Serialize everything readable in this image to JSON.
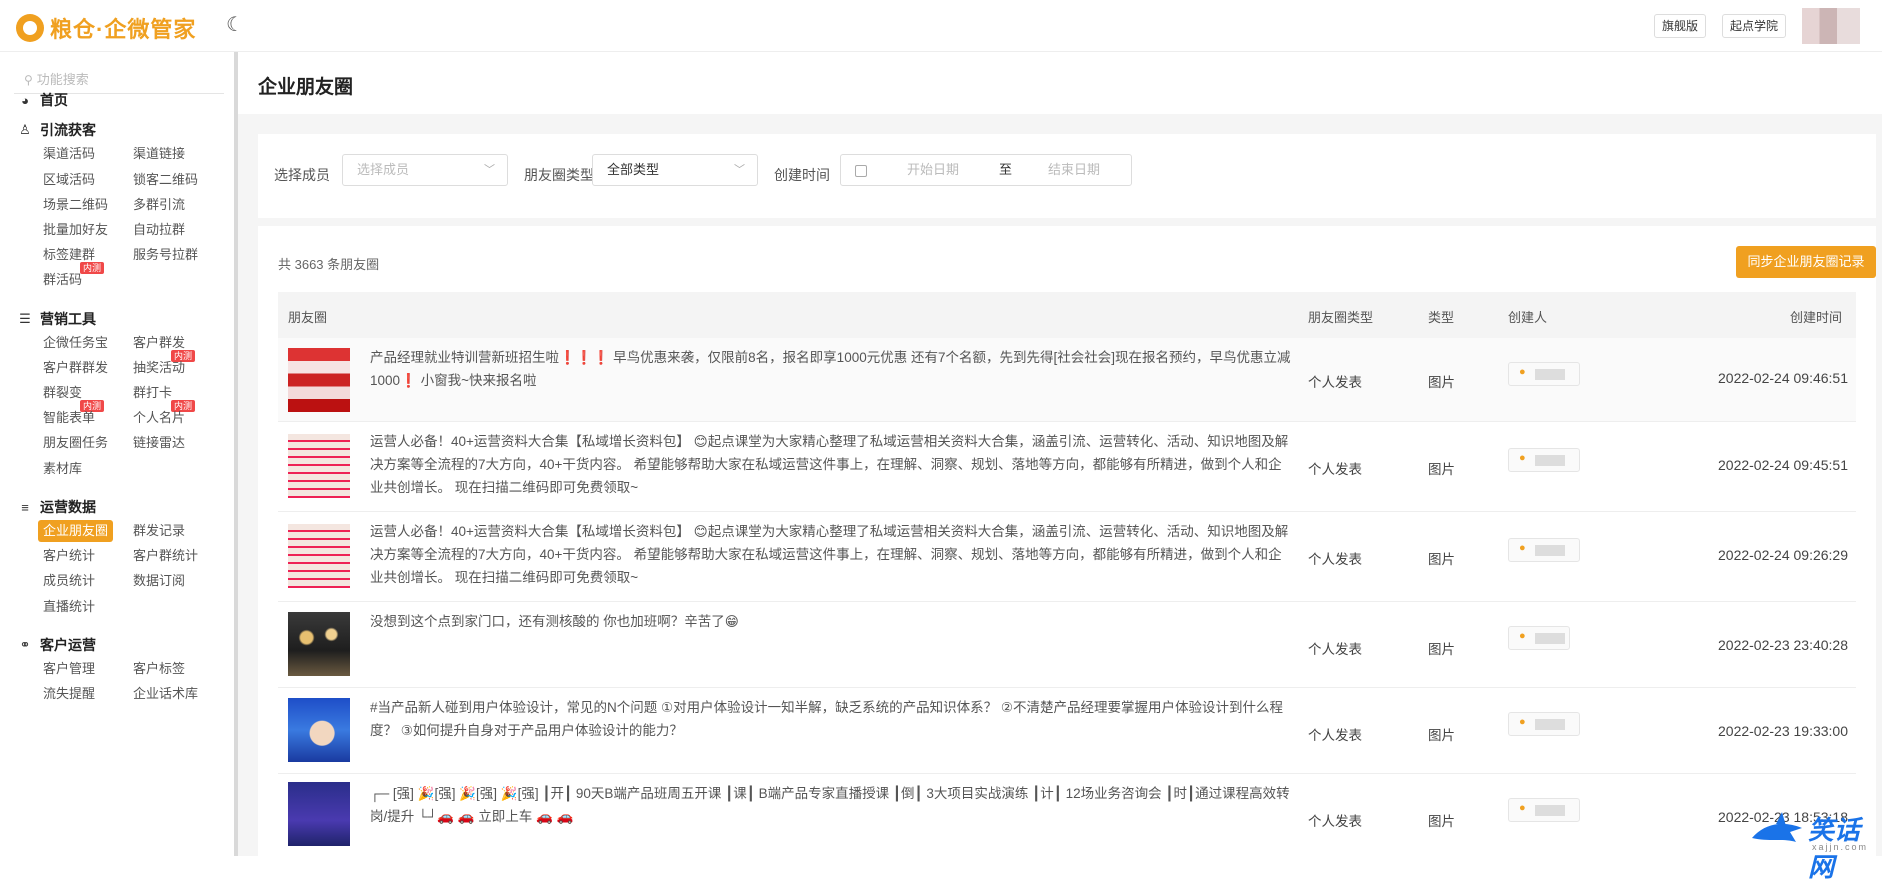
{
  "app": {
    "logo_text": "粮仓·企微管家",
    "flagship_label": "旗舰版",
    "academy_label": "起点学院"
  },
  "sidebar": {
    "search_placeholder": "功能搜索",
    "home": "首页",
    "sections": [
      {
        "title": "引流获客",
        "items": [
          "渠道活码",
          "渠道链接",
          "区域活码",
          "锁客二维码",
          "场景二维码",
          "多群引流",
          "批量加好友",
          "自动拉群",
          "标签建群",
          "服务号拉群",
          "群活码"
        ]
      },
      {
        "title": "营销工具",
        "items": [
          "企微任务宝",
          "客户群发",
          "客户群群发",
          "抽奖活动",
          "群裂变",
          "群打卡",
          "智能表单",
          "个人名片",
          "朋友圈任务",
          "链接雷达",
          "素材库"
        ]
      },
      {
        "title": "运营数据",
        "items": [
          "企业朋友圈",
          "群发记录",
          "客户统计",
          "客户群统计",
          "成员统计",
          "数据订阅",
          "直播统计"
        ]
      },
      {
        "title": "客户运营",
        "items": [
          "客户管理",
          "客户标签",
          "流失提醒",
          "企业话术库"
        ]
      }
    ],
    "badge": "内测"
  },
  "page": {
    "title": "企业朋友圈"
  },
  "filters": {
    "member_label": "选择成员",
    "member_placeholder": "选择成员",
    "type_label": "朋友圈类型",
    "type_value": "全部类型",
    "time_label": "创建时间",
    "start_placeholder": "开始日期",
    "sep": "至",
    "end_placeholder": "结束日期"
  },
  "table": {
    "count_text": "共 3663 条朋友圈",
    "sync_button": "同步企业朋友圈记录",
    "columns": [
      "朋友圈",
      "朋友圈类型",
      "类型",
      "创建人",
      "创建时间"
    ],
    "rows": [
      {
        "content": "产品经理就业特训营新班招生啦❗❗❗ 早鸟优惠来袭，仅限前8名，报名即享1000元优惠 还有7个名额，先到先得[社会社会]现在报名预约，早鸟优惠立减1000❗ 小窗我~快来报名啦",
        "type": "个人发表",
        "kind": "图片",
        "time": "2022-02-24 09:46:51"
      },
      {
        "content": "运营人必备！40+运营资料大合集【私域增长资料包】 😊起点课堂为大家精心整理了私域运营相关资料大合集，涵盖引流、运营转化、活动、知识地图及解决方案等全流程的7大方向，40+干货内容。 希望能够帮助大家在私域运营这件事上，在理解、洞察、规划、落地等方向，都能够有所精进，做到个人和企业共创增长。 现在扫描二维码即可免费领取~",
        "type": "个人发表",
        "kind": "图片",
        "time": "2022-02-24 09:45:51"
      },
      {
        "content": "运营人必备！40+运营资料大合集【私域增长资料包】 😊起点课堂为大家精心整理了私域运营相关资料大合集，涵盖引流、运营转化、活动、知识地图及解决方案等全流程的7大方向，40+干货内容。 希望能够帮助大家在私域运营这件事上，在理解、洞察、规划、落地等方向，都能够有所精进，做到个人和企业共创增长。 现在扫描二维码即可免费领取~",
        "type": "个人发表",
        "kind": "图片",
        "time": "2022-02-24 09:26:29"
      },
      {
        "content": "没想到这个点到家门口，还有测核酸的 你也加班啊？辛苦了😁",
        "type": "个人发表",
        "kind": "图片",
        "time": "2022-02-23 23:40:28"
      },
      {
        "content": "#当产品新人碰到用户体验设计，常见的N个问题 ①对用户体验设计一知半解，缺乏系统的产品知识体系？ ②不清楚产品经理要掌握用户体验设计到什么程度？ ③如何提升自身对于产品用户体验设计的能力？",
        "type": "个人发表",
        "kind": "图片",
        "time": "2022-02-23 19:33:00"
      },
      {
        "content": "┌─ [强] 🎉[强] 🎉[强] 🎉[强] ┃开┃ 90天B端产品班周五开课 ┃课┃ B端产品专家直播授课 ┃倒┃ 3大项目实战演练 ┃计┃ 12场业务咨询会 ┃时┃通过课程高效转岗/提升 └┘🚗 🚗 立即上车 🚗 🚗",
        "type": "个人发表",
        "kind": "图片",
        "time": "2022-02-23 18:53:18"
      }
    ]
  },
  "colors": {
    "accent": "#f0a020",
    "badge": "#f04848"
  },
  "watermark": {
    "text": "笑话网",
    "sub": "xajjn.com"
  }
}
